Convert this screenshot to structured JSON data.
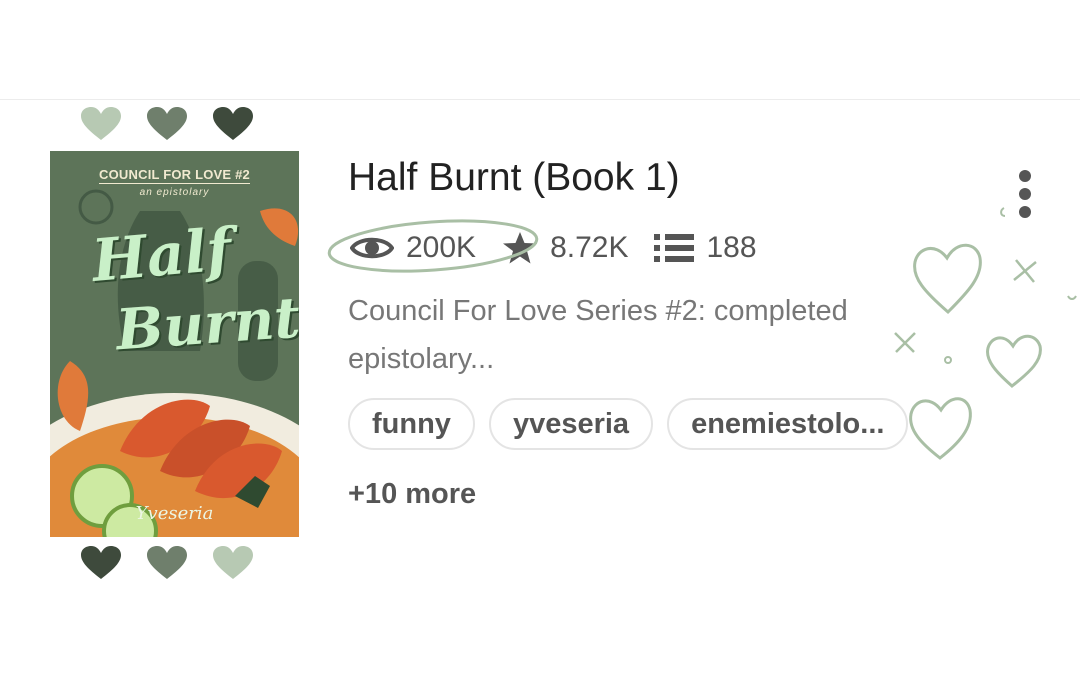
{
  "book": {
    "title": "Half Burnt (Book 1)",
    "stats": {
      "reads": "200K",
      "votes": "8.72K",
      "parts": "188"
    },
    "description": "Council For Love Series #2: completed epistolary...",
    "tags": [
      "funny",
      "yveseria",
      "enemiestolo..."
    ],
    "more_tags": "+10 more"
  },
  "cover": {
    "series_line": "COUNCIL FOR LOVE #2",
    "subtitle": "an epistolary",
    "title_line1": "Half",
    "title_line2": "Burnt",
    "author": "Yveseria"
  },
  "icons": {
    "reads": "eye-icon",
    "votes": "star-icon",
    "parts": "list-icon",
    "menu": "kebab-menu-icon"
  },
  "colors": {
    "cover_green": "#5d7459",
    "heart_light": "#b7c9b3",
    "heart_mid": "#6f7f6c",
    "heart_dark": "#3e4a3c",
    "doodle": "#a9bfa5"
  }
}
